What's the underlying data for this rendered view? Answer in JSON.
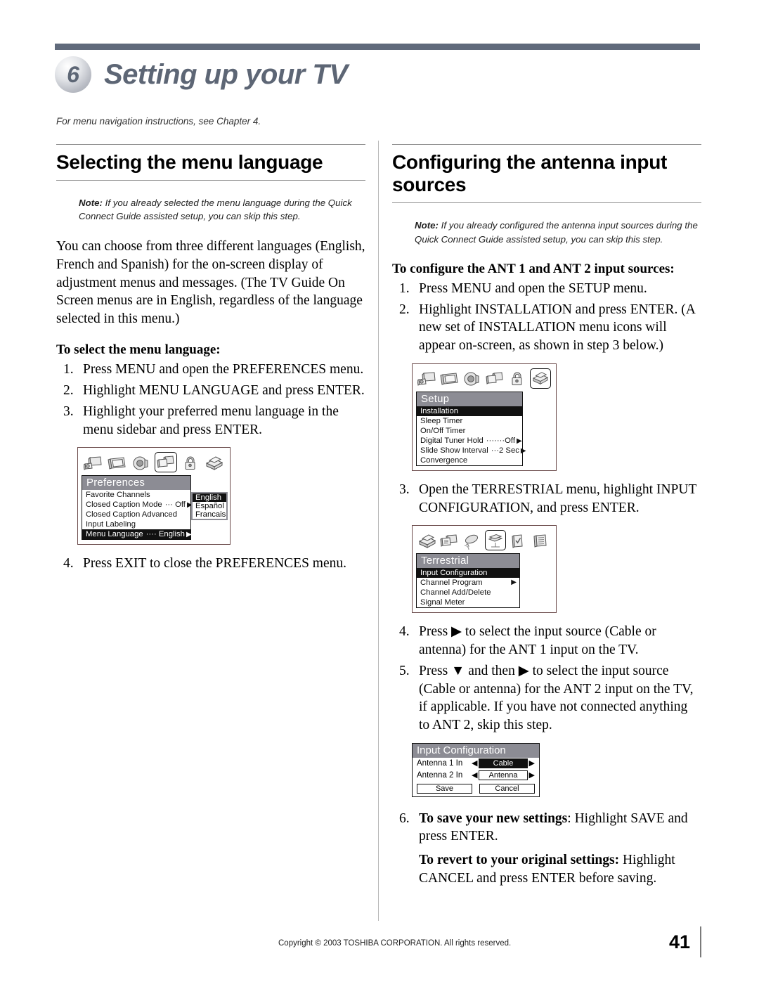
{
  "header": {
    "chapter_number": "6",
    "chapter_title": "Setting up your TV",
    "subnote": "For menu navigation instructions, see Chapter 4."
  },
  "left_column": {
    "section_title": "Selecting the menu language",
    "note_label": "Note:",
    "note_text": " If you already selected the menu language during the Quick Connect Guide assisted setup, you can skip this step.",
    "body": "You can choose from three different languages (English, French and Spanish) for the on-screen display of adjustment menus and messages. (The TV Guide On Screen menus are in English, regardless of the language selected in this menu.)",
    "lead": "To select the menu language:",
    "steps": [
      {
        "num": "1.",
        "text": "Press MENU and open the PREFERENCES menu."
      },
      {
        "num": "2.",
        "text": "Highlight MENU LANGUAGE and press ENTER."
      },
      {
        "num": "3.",
        "text": "Highlight your preferred menu language in the menu sidebar and press ENTER."
      }
    ],
    "step4": {
      "num": "4.",
      "text": "Press EXIT to close the PREFERENCES menu."
    },
    "preferences_osd": {
      "icons": [
        "picture-icon",
        "tv-screen-icon",
        "audio-speaker-icon",
        "preferences-screens-icon",
        "lock-icon",
        "setup-box-icon"
      ],
      "selected_icon_index": 3,
      "title": "Preferences",
      "rows": [
        {
          "label": "Favorite Channels",
          "value": "",
          "arrow": false,
          "highlight": false
        },
        {
          "label": "Closed Caption Mode",
          "dots": "···",
          "value": "Off",
          "arrow": true,
          "highlight": false
        },
        {
          "label": "Closed Caption Advanced",
          "value": "",
          "arrow": false,
          "highlight": false
        },
        {
          "label": "Input Labeling",
          "value": "",
          "arrow": false,
          "highlight": false
        },
        {
          "label": "Menu Language",
          "dots": "····",
          "value": "English",
          "arrow": true,
          "highlight": true
        }
      ],
      "sidebar": [
        {
          "label": "English",
          "highlight": true
        },
        {
          "label": "Español",
          "highlight": false
        },
        {
          "label": "Francais",
          "highlight": false
        }
      ]
    }
  },
  "right_column": {
    "section_title": "Configuring the antenna input sources",
    "note_label": "Note:",
    "note_text": " If you already configured the antenna input sources during the Quick Connect Guide assisted setup, you can skip this step.",
    "lead": "To configure the ANT 1 and ANT 2 input sources:",
    "steps_1_2": [
      {
        "num": "1.",
        "text": "Press MENU and open the SETUP menu."
      },
      {
        "num": "2.",
        "text": "Highlight INSTALLATION and press ENTER. (A new set of INSTALLATION menu icons will appear on-screen, as shown in step 3 below.)"
      }
    ],
    "step3": {
      "num": "3.",
      "text": "Open the TERRESTRIAL menu, highlight INPUT CONFIGURATION, and press ENTER."
    },
    "steps_4_5": [
      {
        "num": "4.",
        "text_before": "Press ",
        "glyph": "▶",
        "text_after": " to select the input source (Cable or antenna) for the ANT 1 input on the TV."
      },
      {
        "num": "5.",
        "text_before": "Press ",
        "glyph": "▼",
        "text_mid": " and then ",
        "glyph2": "▶",
        "text_after": " to select the input source (Cable or antenna) for the ANT 2 input on the TV, if applicable. If you have not connected anything to ANT 2, skip this step."
      }
    ],
    "step6": {
      "num": "6.",
      "bold1": "To save your new settings",
      "text1": ": Highlight SAVE and press ENTER.",
      "bold2": "To revert to your original settings:",
      "text2": " Highlight CANCEL and press ENTER before saving."
    },
    "setup_osd": {
      "icons": [
        "picture-icon",
        "tv-screen-icon",
        "audio-speaker-icon",
        "preferences-screens-icon",
        "lock-icon",
        "setup-box-icon"
      ],
      "selected_icon_index": 5,
      "title": "Setup",
      "rows": [
        {
          "label": "Installation",
          "value": "",
          "arrow": false,
          "highlight": true
        },
        {
          "label": "Sleep Timer",
          "value": "",
          "arrow": false,
          "highlight": false
        },
        {
          "label": "On/Off Timer",
          "value": "",
          "arrow": false,
          "highlight": false
        },
        {
          "label": "Digital Tuner Hold",
          "dots": "·······",
          "value": "Off",
          "arrow": true,
          "highlight": false
        },
        {
          "label": "Slide Show Interval",
          "dots": "···",
          "value": "2 Sec",
          "arrow": true,
          "highlight": false
        },
        {
          "label": "Convergence",
          "value": "",
          "arrow": false,
          "highlight": false
        }
      ]
    },
    "terrestrial_osd": {
      "icons": [
        "setup-box-icon",
        "input-labeling-icon",
        "satellite-dish-icon",
        "terrestrial-antenna-icon",
        "check-box-icon",
        "channel-list-icon"
      ],
      "selected_icon_index": 3,
      "title": "Terrestrial",
      "rows": [
        {
          "label": "Input Configuration",
          "value": "",
          "arrow": false,
          "highlight": true
        },
        {
          "label": "Channel Program",
          "value": "",
          "arrow": true,
          "highlight": false
        },
        {
          "label": "Channel Add/Delete",
          "value": "",
          "arrow": false,
          "highlight": false
        },
        {
          "label": "Signal Meter",
          "value": "",
          "arrow": false,
          "highlight": false
        }
      ]
    },
    "input_configuration_osd": {
      "title": "Input Configuration",
      "rows": [
        {
          "label": "Antenna 1 In",
          "value": "Cable",
          "selected": true
        },
        {
          "label": "Antenna 2 In",
          "value": "Antenna",
          "selected": false
        }
      ],
      "buttons": [
        {
          "label": "Save"
        },
        {
          "label": "Cancel"
        }
      ]
    }
  },
  "footer": {
    "copyright": "Copyright © 2003 TOSHIBA CORPORATION. All rights reserved.",
    "page_number": "41"
  },
  "colors": {
    "band": "#606a7b",
    "chapter_text": "#5d6675",
    "osd_title_bar": "#8c8c94",
    "osd_highlight": "#111111"
  }
}
